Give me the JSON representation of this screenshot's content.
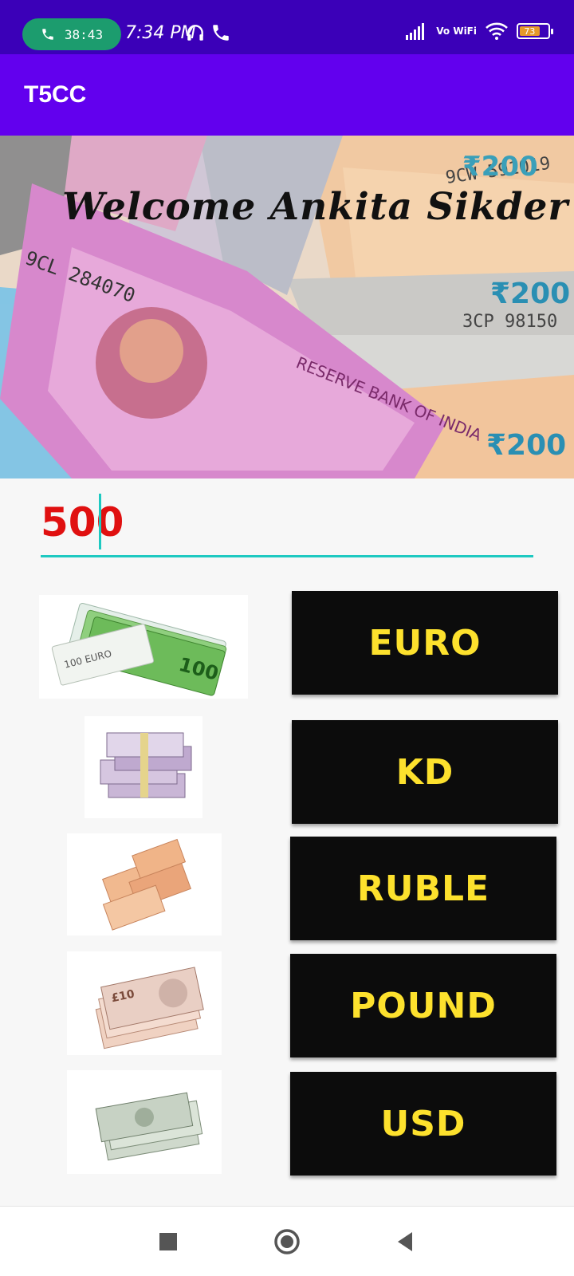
{
  "status_bar": {
    "call_timer": "38:43",
    "time": "7:34 PM",
    "vowifi": "Vo WiFi",
    "battery_level": "73"
  },
  "app_bar": {
    "title": "T5CC"
  },
  "banner": {
    "welcome_text": "Welcome Ankita Sikder"
  },
  "amount_input": {
    "value": "500"
  },
  "currencies": [
    {
      "label": "EURO",
      "image_icon": "euro-notes-image"
    },
    {
      "label": "KD",
      "image_icon": "kd-notes-image"
    },
    {
      "label": "RUBLE",
      "image_icon": "ruble-notes-image"
    },
    {
      "label": "POUND",
      "image_icon": "pound-notes-image"
    },
    {
      "label": "USD",
      "image_icon": "usd-notes-image"
    }
  ],
  "colors": {
    "status_bar": "#3b00b8",
    "app_bar": "#6200ee",
    "button_bg": "#0c0c0c",
    "button_text": "#fde12d",
    "input_text": "#e01010",
    "input_underline": "#1ec9c1"
  }
}
